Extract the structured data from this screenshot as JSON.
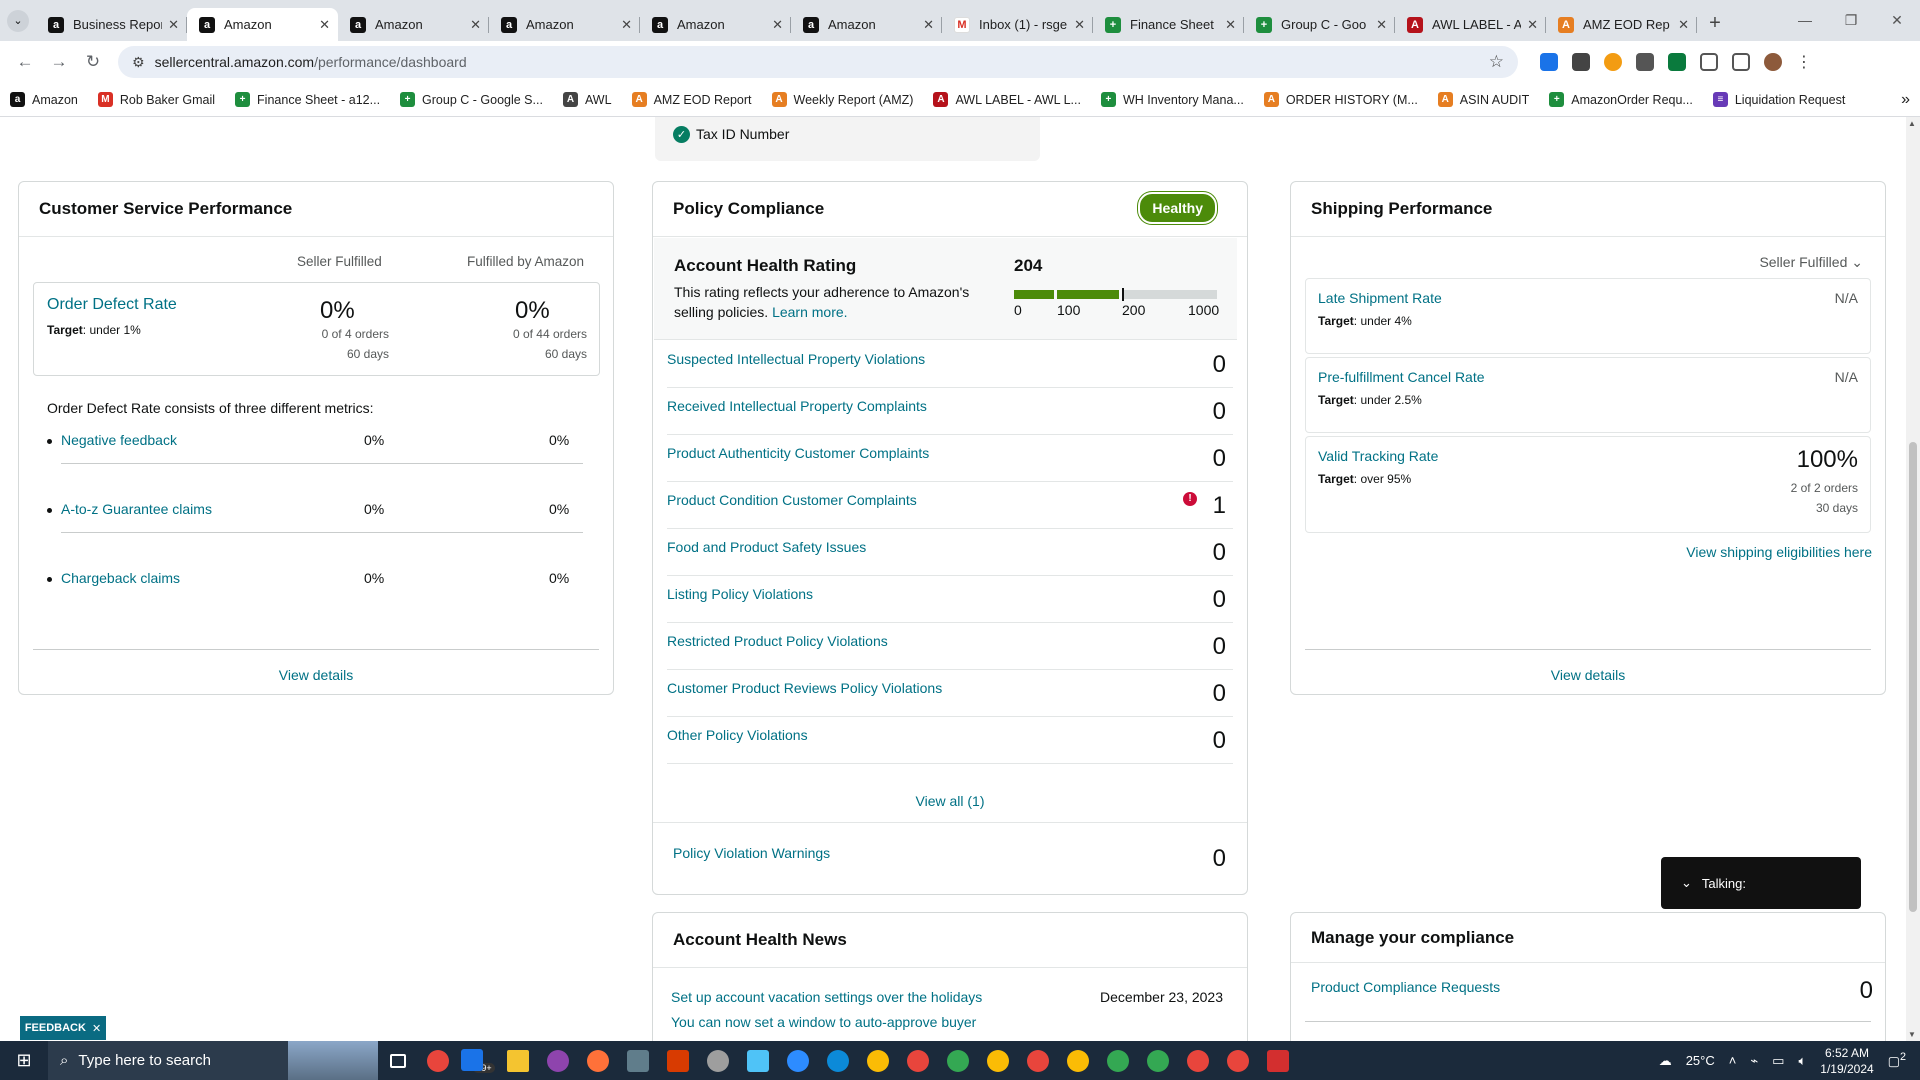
{
  "browser": {
    "tabs": [
      {
        "title": "Business Repor",
        "icon": "amazon",
        "active": false
      },
      {
        "title": "Amazon",
        "icon": "amazon",
        "active": true
      },
      {
        "title": "Amazon",
        "icon": "amazon",
        "active": false
      },
      {
        "title": "Amazon",
        "icon": "amazon",
        "active": false
      },
      {
        "title": "Amazon",
        "icon": "amazon",
        "active": false
      },
      {
        "title": "Amazon",
        "icon": "amazon",
        "active": false
      },
      {
        "title": "Inbox (1) - rsge",
        "icon": "mail",
        "active": false
      },
      {
        "title": "Finance Sheet",
        "icon": "sheet",
        "active": false
      },
      {
        "title": "Group C - Goo",
        "icon": "sheet",
        "active": false
      },
      {
        "title": "AWL LABEL - A",
        "icon": "awl",
        "active": false
      },
      {
        "title": "AMZ EOD Rep",
        "icon": "eod",
        "active": false
      }
    ],
    "url_host": "sellercentral.amazon.com",
    "url_path": "/performance/dashboard",
    "bookmarks": [
      {
        "label": "Amazon",
        "color": "#111111",
        "glyph": "a"
      },
      {
        "label": "Rob Baker Gmail",
        "color": "#d93025",
        "glyph": "M"
      },
      {
        "label": "Finance Sheet - a12...",
        "color": "#1e8e3e",
        "glyph": "+"
      },
      {
        "label": "Group C - Google S...",
        "color": "#1e8e3e",
        "glyph": "+"
      },
      {
        "label": "AWL",
        "color": "#444444",
        "glyph": "A"
      },
      {
        "label": "AMZ EOD Report",
        "color": "#e67e22",
        "glyph": "A"
      },
      {
        "label": "Weekly Report (AMZ)",
        "color": "#e67e22",
        "glyph": "A"
      },
      {
        "label": "AWL LABEL - AWL L...",
        "color": "#b5121b",
        "glyph": "A"
      },
      {
        "label": "WH Inventory Mana...",
        "color": "#1e8e3e",
        "glyph": "+"
      },
      {
        "label": "ORDER HISTORY (M...",
        "color": "#e67e22",
        "glyph": "A"
      },
      {
        "label": "ASIN AUDIT",
        "color": "#e67e22",
        "glyph": "A"
      },
      {
        "label": "AmazonOrder Requ...",
        "color": "#1e8e3e",
        "glyph": "+"
      },
      {
        "label": "Liquidation Request",
        "color": "#673ab7",
        "glyph": "≡"
      }
    ]
  },
  "tax": {
    "label": "Tax ID Number"
  },
  "customer_service": {
    "title": "Customer Service Performance",
    "col_seller": "Seller Fulfilled",
    "col_fba": "Fulfilled by Amazon",
    "odr_title": "Order Defect Rate",
    "odr_target_label": "Target",
    "odr_target": ": under 1%",
    "seller_pct": "0%",
    "seller_orders": "0 of 4 orders",
    "seller_days": "60 days",
    "fba_pct": "0%",
    "fba_orders": "0 of 44 orders",
    "fba_days": "60 days",
    "note": "Order Defect Rate consists of three different metrics:",
    "metrics": [
      {
        "label": "Negative feedback",
        "seller": "0%",
        "fba": "0%"
      },
      {
        "label": "A-to-z Guarantee claims",
        "seller": "0%",
        "fba": "0%"
      },
      {
        "label": "Chargeback claims",
        "seller": "0%",
        "fba": "0%"
      }
    ],
    "view_details": "View details"
  },
  "policy": {
    "title": "Policy Compliance",
    "status": "Healthy",
    "ahr_title": "Account Health Rating",
    "ahr_desc": "This rating reflects your adherence to Amazon's selling policies.",
    "learn_more": "Learn more.",
    "score": "204",
    "score_value": 204,
    "scale_labels": [
      "0",
      "100",
      "200",
      "1000"
    ],
    "rows": [
      {
        "label": "Suspected Intellectual Property Violations",
        "count": "0",
        "alert": false
      },
      {
        "label": "Received Intellectual Property Complaints",
        "count": "0",
        "alert": false
      },
      {
        "label": "Product Authenticity Customer Complaints",
        "count": "0",
        "alert": false
      },
      {
        "label": "Product Condition Customer Complaints",
        "count": "1",
        "alert": true
      },
      {
        "label": "Food and Product Safety Issues",
        "count": "0",
        "alert": false
      },
      {
        "label": "Listing Policy Violations",
        "count": "0",
        "alert": false
      },
      {
        "label": "Restricted Product Policy Violations",
        "count": "0",
        "alert": false
      },
      {
        "label": "Customer Product Reviews Policy Violations",
        "count": "0",
        "alert": false
      },
      {
        "label": "Other Policy Violations",
        "count": "0",
        "alert": false
      }
    ],
    "view_all": "View all (1)",
    "warnings_label": "Policy Violation Warnings",
    "warnings_count": "0"
  },
  "shipping": {
    "title": "Shipping Performance",
    "filter": "Seller Fulfilled",
    "rows": [
      {
        "label": "Late Shipment Rate",
        "target_label": "Target",
        "target": ": under 4%",
        "value": "N/A"
      },
      {
        "label": "Pre-fulfillment Cancel Rate",
        "target_label": "Target",
        "target": ": under 2.5%",
        "value": "N/A"
      },
      {
        "label": "Valid Tracking Rate",
        "target_label": "Target",
        "target": ": over 95%",
        "value": "100%",
        "orders": "2 of 2 orders",
        "days": "30 days"
      }
    ],
    "eligibility_link": "View shipping eligibilities here",
    "view_details": "View details"
  },
  "news": {
    "title": "Account Health News",
    "items": [
      {
        "label": "Set up account vacation settings over the holidays",
        "date": "December 23, 2023"
      },
      {
        "label": "You can now set a window to auto-approve buyer",
        "date": ""
      }
    ]
  },
  "compliance": {
    "title": "Manage your compliance",
    "row_label": "Product Compliance Requests",
    "row_count": "0"
  },
  "talking": {
    "label": "Talking:"
  },
  "feedback": {
    "label": "FEEDBACK"
  },
  "taskbar": {
    "search_placeholder": "Type here to search",
    "weather": "25°C",
    "time": "6:52 AM",
    "date": "1/19/2024",
    "mail_badge": "99+",
    "notif_badge": "2"
  }
}
